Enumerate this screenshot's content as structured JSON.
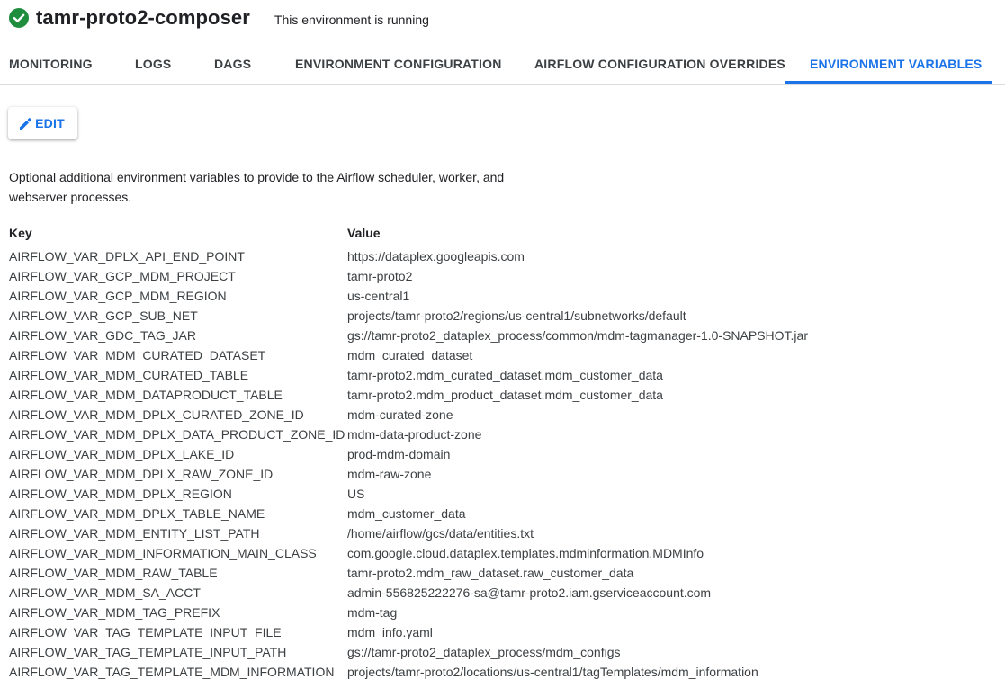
{
  "header": {
    "title": "tamr-proto2-composer",
    "status_text": "This environment is running",
    "status_icon": "check-circle-icon",
    "status_color": "#1e8e3e"
  },
  "tabs": [
    {
      "label": "MONITORING",
      "active": false
    },
    {
      "label": "LOGS",
      "active": false
    },
    {
      "label": "DAGS",
      "active": false
    },
    {
      "label": "ENVIRONMENT CONFIGURATION",
      "active": false
    },
    {
      "label": "AIRFLOW CONFIGURATION OVERRIDES",
      "active": false
    },
    {
      "label": "ENVIRONMENT VARIABLES",
      "active": true
    }
  ],
  "accent_color": "#1a73e8",
  "toolbar": {
    "edit_label": "EDIT",
    "edit_icon": "pencil-icon"
  },
  "description": "Optional additional environment variables to provide to the Airflow scheduler, worker, and webserver processes.",
  "table": {
    "headers": {
      "key": "Key",
      "value": "Value"
    },
    "rows": [
      {
        "key": "AIRFLOW_VAR_DPLX_API_END_POINT",
        "value": "https://dataplex.googleapis.com"
      },
      {
        "key": "AIRFLOW_VAR_GCP_MDM_PROJECT",
        "value": "tamr-proto2"
      },
      {
        "key": "AIRFLOW_VAR_GCP_MDM_REGION",
        "value": "us-central1"
      },
      {
        "key": "AIRFLOW_VAR_GCP_SUB_NET",
        "value": "projects/tamr-proto2/regions/us-central1/subnetworks/default"
      },
      {
        "key": "AIRFLOW_VAR_GDC_TAG_JAR",
        "value": "gs://tamr-proto2_dataplex_process/common/mdm-tagmanager-1.0-SNAPSHOT.jar"
      },
      {
        "key": "AIRFLOW_VAR_MDM_CURATED_DATASET",
        "value": "mdm_curated_dataset"
      },
      {
        "key": "AIRFLOW_VAR_MDM_CURATED_TABLE",
        "value": "tamr-proto2.mdm_curated_dataset.mdm_customer_data"
      },
      {
        "key": "AIRFLOW_VAR_MDM_DATAPRODUCT_TABLE",
        "value": "tamr-proto2.mdm_product_dataset.mdm_customer_data"
      },
      {
        "key": "AIRFLOW_VAR_MDM_DPLX_CURATED_ZONE_ID",
        "value": "mdm-curated-zone"
      },
      {
        "key": "AIRFLOW_VAR_MDM_DPLX_DATA_PRODUCT_ZONE_ID",
        "value": "mdm-data-product-zone"
      },
      {
        "key": "AIRFLOW_VAR_MDM_DPLX_LAKE_ID",
        "value": "prod-mdm-domain"
      },
      {
        "key": "AIRFLOW_VAR_MDM_DPLX_RAW_ZONE_ID",
        "value": "mdm-raw-zone"
      },
      {
        "key": "AIRFLOW_VAR_MDM_DPLX_REGION",
        "value": "US"
      },
      {
        "key": "AIRFLOW_VAR_MDM_DPLX_TABLE_NAME",
        "value": "mdm_customer_data"
      },
      {
        "key": "AIRFLOW_VAR_MDM_ENTITY_LIST_PATH",
        "value": "/home/airflow/gcs/data/entities.txt"
      },
      {
        "key": "AIRFLOW_VAR_MDM_INFORMATION_MAIN_CLASS",
        "value": "com.google.cloud.dataplex.templates.mdminformation.MDMInfo"
      },
      {
        "key": "AIRFLOW_VAR_MDM_RAW_TABLE",
        "value": "tamr-proto2.mdm_raw_dataset.raw_customer_data"
      },
      {
        "key": "AIRFLOW_VAR_MDM_SA_ACCT",
        "value": "admin-556825222276-sa@tamr-proto2.iam.gserviceaccount.com"
      },
      {
        "key": "AIRFLOW_VAR_MDM_TAG_PREFIX",
        "value": "mdm-tag"
      },
      {
        "key": "AIRFLOW_VAR_TAG_TEMPLATE_INPUT_FILE",
        "value": "mdm_info.yaml"
      },
      {
        "key": "AIRFLOW_VAR_TAG_TEMPLATE_INPUT_PATH",
        "value": "gs://tamr-proto2_dataplex_process/mdm_configs"
      },
      {
        "key": "AIRFLOW_VAR_TAG_TEMPLATE_MDM_INFORMATION",
        "value": "projects/tamr-proto2/locations/us-central1/tagTemplates/mdm_information"
      }
    ]
  }
}
